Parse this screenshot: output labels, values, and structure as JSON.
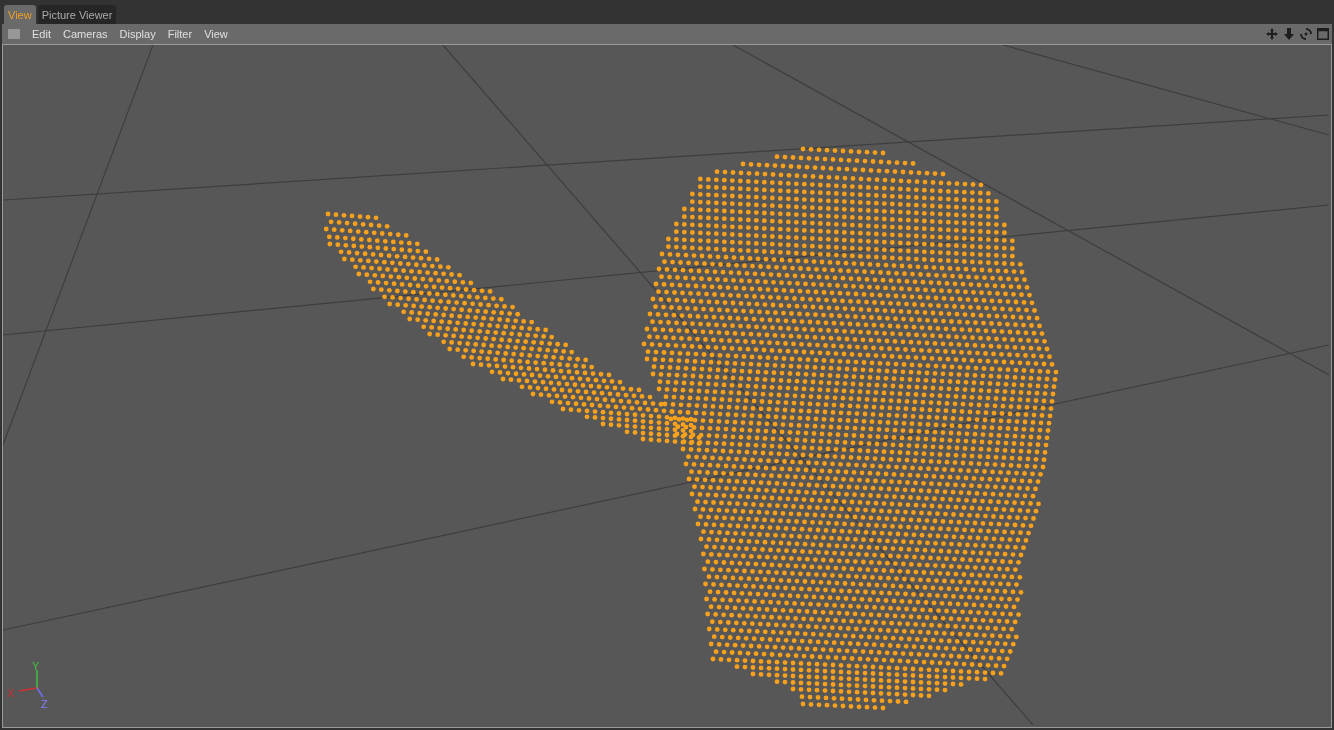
{
  "tabs": [
    {
      "label": "View",
      "selected": true
    },
    {
      "label": "Picture Viewer",
      "selected": false
    }
  ],
  "menu": [
    "Edit",
    "Cameras",
    "Display",
    "Filter",
    "View"
  ],
  "axes": {
    "x": "X",
    "y": "Y",
    "z": "Z"
  }
}
